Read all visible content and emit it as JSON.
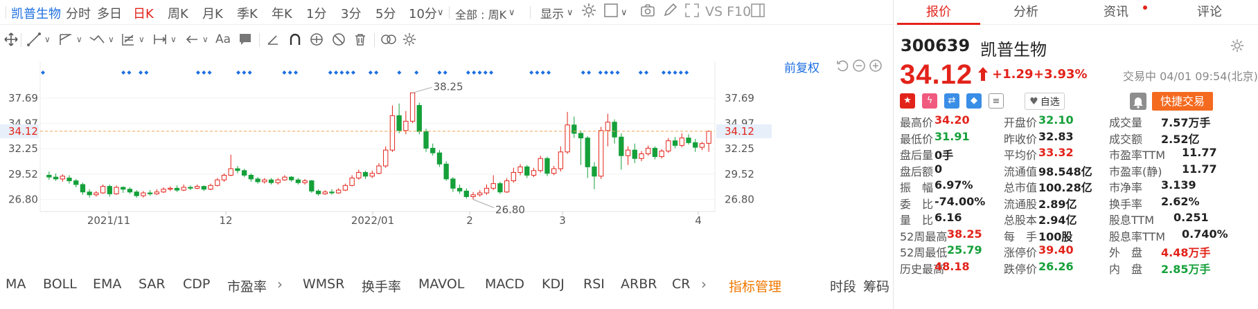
{
  "topbar": {
    "stock_name": "凯普生物",
    "timeframes": [
      "分时",
      "多日",
      "日K",
      "周K",
      "月K",
      "季K",
      "年K",
      "1分",
      "3分",
      "5分",
      "10分"
    ],
    "period_select": "全部 : 周K",
    "display": "显示",
    "vs_label": "VS F10"
  },
  "chart": {
    "fq_label": "前复权",
    "price_ticks": [
      "37.69",
      "34.97",
      "32.25",
      "29.52",
      "26.80"
    ],
    "current_price_label": "34.12",
    "x_labels": [
      "2021/11",
      "12",
      "2022/01",
      "2",
      "3",
      "4"
    ],
    "high_annotation": "38.25",
    "low_annotation": "26.80",
    "colors": {
      "up": "#e2231a",
      "down": "#15a03a",
      "marker": "#1d6fe0",
      "current_line": "#f0a050"
    }
  },
  "chart_data": {
    "type": "candlestick",
    "ylim": [
      25.5,
      40.5
    ],
    "current_price": 34.12,
    "high_point": 38.25,
    "low_point": 26.8,
    "x_labels": [
      "2021/11",
      "12",
      "2022/01",
      "2",
      "3",
      "4"
    ],
    "candles": [
      [
        29.4,
        29.2,
        29.8,
        28.9
      ],
      [
        29.2,
        29.0,
        29.6,
        28.8
      ],
      [
        29.0,
        29.3,
        29.5,
        28.7
      ],
      [
        29.1,
        28.8,
        29.4,
        28.5
      ],
      [
        28.8,
        28.4,
        29.0,
        28.1
      ],
      [
        28.4,
        27.6,
        28.6,
        27.3
      ],
      [
        27.6,
        27.3,
        27.9,
        27.0
      ],
      [
        27.3,
        27.5,
        27.7,
        27.1
      ],
      [
        27.5,
        28.2,
        28.4,
        27.4
      ],
      [
        28.2,
        27.4,
        28.4,
        27.1
      ],
      [
        27.4,
        28.1,
        28.3,
        27.3
      ],
      [
        28.1,
        27.9,
        28.2,
        27.5
      ],
      [
        27.9,
        27.6,
        28.1,
        27.4
      ],
      [
        27.6,
        27.2,
        27.8,
        27.0
      ],
      [
        27.2,
        27.5,
        27.7,
        27.0
      ],
      [
        27.5,
        27.4,
        27.8,
        27.2
      ],
      [
        27.4,
        27.6,
        27.9,
        27.3
      ],
      [
        27.6,
        27.9,
        28.1,
        27.5
      ],
      [
        27.9,
        28.0,
        28.2,
        27.7
      ],
      [
        28.0,
        27.8,
        28.3,
        27.6
      ],
      [
        27.8,
        28.1,
        28.4,
        27.7
      ],
      [
        28.1,
        28.0,
        28.3,
        27.8
      ],
      [
        28.0,
        28.2,
        28.4,
        27.9
      ],
      [
        28.2,
        27.9,
        28.3,
        27.7
      ],
      [
        27.9,
        28.3,
        28.5,
        27.8
      ],
      [
        28.3,
        28.9,
        29.1,
        28.2
      ],
      [
        28.9,
        29.4,
        29.6,
        28.7
      ],
      [
        29.4,
        30.1,
        31.6,
        29.3
      ],
      [
        30.1,
        29.9,
        30.4,
        29.6
      ],
      [
        29.9,
        29.4,
        30.1,
        29.2
      ],
      [
        29.4,
        29.0,
        29.6,
        28.7
      ],
      [
        29.0,
        28.7,
        29.2,
        28.5
      ],
      [
        28.7,
        28.9,
        29.1,
        28.5
      ],
      [
        28.9,
        28.6,
        29.1,
        28.4
      ],
      [
        28.6,
        28.9,
        29.1,
        28.4
      ],
      [
        28.9,
        29.2,
        29.4,
        28.8
      ],
      [
        29.2,
        28.9,
        29.3,
        28.7
      ],
      [
        28.9,
        28.6,
        29.1,
        28.4
      ],
      [
        28.6,
        28.8,
        29.0,
        28.4
      ],
      [
        28.8,
        27.7,
        28.9,
        27.5
      ],
      [
        27.7,
        27.4,
        27.9,
        27.2
      ],
      [
        27.4,
        27.6,
        27.8,
        27.3
      ],
      [
        27.6,
        27.5,
        27.9,
        27.3
      ],
      [
        27.5,
        27.8,
        28.0,
        27.4
      ],
      [
        27.8,
        28.3,
        28.5,
        27.7
      ],
      [
        28.3,
        29.1,
        29.4,
        28.2
      ],
      [
        29.1,
        29.7,
        30.0,
        28.9
      ],
      [
        29.7,
        29.3,
        29.9,
        29.0
      ],
      [
        29.3,
        29.6,
        29.9,
        29.1
      ],
      [
        29.6,
        30.4,
        30.7,
        29.5
      ],
      [
        30.4,
        32.1,
        32.5,
        30.2
      ],
      [
        32.1,
        35.8,
        36.9,
        31.9
      ],
      [
        35.8,
        34.2,
        37.1,
        33.9
      ],
      [
        34.2,
        35.2,
        36.3,
        33.8
      ],
      [
        35.2,
        38.25,
        38.25,
        35.0
      ],
      [
        36.9,
        34.1,
        37.2,
        33.8
      ],
      [
        34.1,
        32.3,
        34.4,
        31.9
      ],
      [
        32.3,
        31.8,
        32.8,
        31.5
      ],
      [
        31.8,
        30.6,
        32.1,
        30.3
      ],
      [
        30.6,
        29.0,
        30.9,
        28.8
      ],
      [
        29.0,
        28.0,
        29.2,
        27.6
      ],
      [
        28.0,
        27.7,
        28.4,
        27.4
      ],
      [
        27.7,
        27.1,
        28.0,
        26.9
      ],
      [
        27.1,
        27.3,
        27.6,
        26.8
      ],
      [
        27.3,
        27.5,
        27.8,
        27.1
      ],
      [
        27.5,
        28.0,
        28.4,
        27.3
      ],
      [
        28.0,
        28.5,
        29.4,
        27.8
      ],
      [
        28.5,
        27.6,
        28.7,
        27.4
      ],
      [
        27.6,
        28.8,
        29.1,
        27.5
      ],
      [
        28.8,
        29.7,
        30.2,
        28.6
      ],
      [
        29.7,
        30.3,
        30.6,
        29.4
      ],
      [
        30.3,
        29.4,
        30.5,
        29.1
      ],
      [
        29.4,
        29.9,
        30.2,
        29.2
      ],
      [
        29.9,
        31.2,
        31.5,
        29.7
      ],
      [
        31.2,
        29.6,
        31.4,
        29.3
      ],
      [
        29.6,
        30.1,
        30.4,
        29.4
      ],
      [
        30.1,
        31.9,
        32.5,
        29.8
      ],
      [
        31.9,
        34.8,
        36.2,
        31.7
      ],
      [
        34.8,
        33.9,
        35.7,
        33.4
      ],
      [
        33.9,
        33.4,
        34.2,
        30.5
      ],
      [
        33.4,
        30.3,
        33.6,
        29.1
      ],
      [
        30.3,
        29.3,
        30.8,
        27.9
      ],
      [
        29.3,
        34.2,
        34.6,
        29.0
      ],
      [
        34.2,
        35.1,
        36.0,
        32.5
      ],
      [
        35.1,
        33.5,
        35.4,
        32.8
      ],
      [
        33.5,
        31.5,
        33.9,
        30.0
      ],
      [
        31.5,
        32.1,
        32.5,
        30.5
      ],
      [
        32.1,
        31.2,
        32.8,
        30.7
      ],
      [
        31.2,
        31.7,
        32.0,
        30.9
      ],
      [
        31.7,
        32.3,
        32.6,
        31.5
      ],
      [
        32.3,
        31.4,
        32.5,
        31.1
      ],
      [
        31.4,
        32.0,
        32.2,
        31.2
      ],
      [
        32.0,
        33.1,
        33.4,
        31.8
      ],
      [
        33.1,
        32.6,
        33.5,
        32.3
      ],
      [
        32.6,
        33.4,
        33.9,
        32.4
      ],
      [
        33.4,
        32.9,
        33.8,
        32.7
      ],
      [
        32.9,
        32.4,
        33.3,
        31.9
      ],
      [
        32.4,
        32.8,
        33.0,
        32.1
      ],
      [
        32.83,
        34.12,
        34.2,
        31.91
      ]
    ]
  },
  "indicators": {
    "items": [
      "MA",
      "BOLL",
      "EMA",
      "SAR",
      "CDP",
      "市盈率",
      "WMSR",
      "换手率",
      "MAVOL",
      "MACD",
      "KDJ",
      "RSI",
      "ARBR",
      "CR"
    ],
    "manage": "指标管理",
    "right": [
      "时段",
      "筹码"
    ]
  },
  "panel": {
    "tabs": [
      "报价",
      "分析",
      "资讯",
      "评论"
    ],
    "code": "300639",
    "name": "凯普生物",
    "price": "34.12",
    "change": "+1.29",
    "change_pct": "+3.93%",
    "status": "交易中 04/01 09:54(北京)",
    "zixuan": "自选",
    "quick_trade": "快捷交易",
    "stats": [
      [
        {
          "l": "最高价",
          "v": "34.20",
          "c": "red"
        },
        {
          "l": "开盘价",
          "v": "32.10",
          "c": "green"
        },
        {
          "l": "成交量",
          "v": "7.57万手",
          "c": ""
        }
      ],
      [
        {
          "l": "最低价",
          "v": "31.91",
          "c": "green"
        },
        {
          "l": "昨收价",
          "v": "32.83",
          "c": ""
        },
        {
          "l": "成交额",
          "v": "2.52亿",
          "c": ""
        }
      ],
      [
        {
          "l": "盘后量",
          "v": "0手",
          "c": ""
        },
        {
          "l": "平均价",
          "v": "33.32",
          "c": "red"
        },
        {
          "l": "市盈率TTM",
          "v": "11.77",
          "c": ""
        }
      ],
      [
        {
          "l": "盘后额",
          "v": "0",
          "c": ""
        },
        {
          "l": "流通值",
          "v": "98.548亿",
          "c": ""
        },
        {
          "l": "市盈率(静)",
          "v": "11.77",
          "c": ""
        }
      ],
      [
        {
          "l": "振　幅",
          "v": "6.97%",
          "c": ""
        },
        {
          "l": "总市值",
          "v": "100.28亿",
          "c": ""
        },
        {
          "l": "市净率",
          "v": "3.139",
          "c": ""
        }
      ],
      [
        {
          "l": "委　比",
          "v": "-74.00%",
          "c": ""
        },
        {
          "l": "流通股",
          "v": "2.89亿",
          "c": ""
        },
        {
          "l": "换手率",
          "v": "2.62%",
          "c": ""
        }
      ],
      [
        {
          "l": "量　比",
          "v": "6.16",
          "c": ""
        },
        {
          "l": "总股本",
          "v": "2.94亿",
          "c": ""
        },
        {
          "l": "股息TTM",
          "v": "0.251",
          "c": ""
        }
      ],
      [
        {
          "l": "52周最高",
          "v": "38.25",
          "c": "red"
        },
        {
          "l": "每　手",
          "v": "100股",
          "c": ""
        },
        {
          "l": "股息率TTM",
          "v": "0.740%",
          "c": ""
        }
      ],
      [
        {
          "l": "52周最低",
          "v": "25.79",
          "c": "green"
        },
        {
          "l": "涨停价",
          "v": "39.40",
          "c": "red"
        },
        {
          "l": "外　盘",
          "v": "4.48万手",
          "c": "red"
        }
      ],
      [
        {
          "l": "历史最高",
          "v": "48.18",
          "c": "red"
        },
        {
          "l": "跌停价",
          "v": "26.26",
          "c": "green"
        },
        {
          "l": "内　盘",
          "v": "2.85万手",
          "c": "green"
        }
      ]
    ]
  }
}
